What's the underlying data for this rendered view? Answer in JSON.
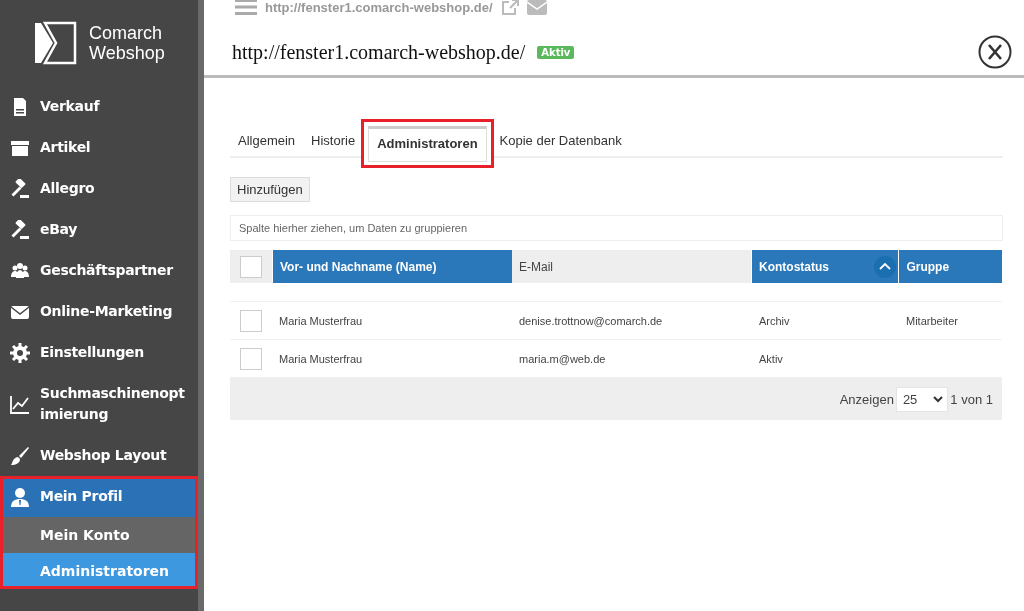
{
  "sidebar": {
    "logo": {
      "line1": "Comarch",
      "line2": "Webshop"
    },
    "items": [
      {
        "label": "Verkauf",
        "selected": false
      },
      {
        "label": "Artikel",
        "selected": false
      },
      {
        "label": "Allegro",
        "selected": false
      },
      {
        "label": "eBay",
        "selected": false
      },
      {
        "label": "Geschäftspartner",
        "selected": false
      },
      {
        "label": "Online-Marketing",
        "selected": false
      },
      {
        "label": "Einstellungen",
        "selected": false
      },
      {
        "label": "Suchmaschinenopt imierung",
        "selected": false
      },
      {
        "label": "Webshop Layout",
        "selected": false
      },
      {
        "label": "Mein Profil",
        "selected": true,
        "children": [
          {
            "label": "Mein Konto",
            "selected": false
          },
          {
            "label": "Administratoren",
            "selected": true
          }
        ]
      }
    ]
  },
  "topbar": {
    "url": "http://fenster1.comarch-webshop.de/"
  },
  "header": {
    "title": "http://fenster1.comarch-webshop.de/",
    "status": "Aktiv"
  },
  "tabs": [
    {
      "label": "Allgemein",
      "selected": false
    },
    {
      "label": "Historie",
      "selected": false
    },
    {
      "label": "Administratoren",
      "selected": true
    },
    {
      "label": "Kopie der Datenbank",
      "selected": false
    }
  ],
  "add_button": "Hinzufügen",
  "group_panel": {
    "placeholder": "Spalte hierher ziehen, um Daten zu gruppieren"
  },
  "table": {
    "select_all": {
      "checked": false
    },
    "columns": [
      {
        "label": "Vor- und Nachname (Name)",
        "highlighted": true,
        "sorted": false
      },
      {
        "label": "E-Mail",
        "highlighted": false,
        "sorted": false
      },
      {
        "label": "Kontostatus",
        "highlighted": true,
        "sorted": true
      },
      {
        "label": "Gruppe",
        "highlighted": true,
        "sorted": false
      }
    ],
    "rows": [
      {
        "checked": false,
        "cells": [
          "Maria Musterfrau",
          "denise.trottnow@comarch.de",
          "Archiv",
          "Mitarbeiter"
        ]
      },
      {
        "checked": false,
        "cells": [
          "Maria Musterfrau",
          "maria.m@web.de",
          "Aktiv"
        ]
      }
    ]
  },
  "pager": {
    "label": "Anzeigen",
    "page_size": "25",
    "page_info": "1 von 1"
  }
}
